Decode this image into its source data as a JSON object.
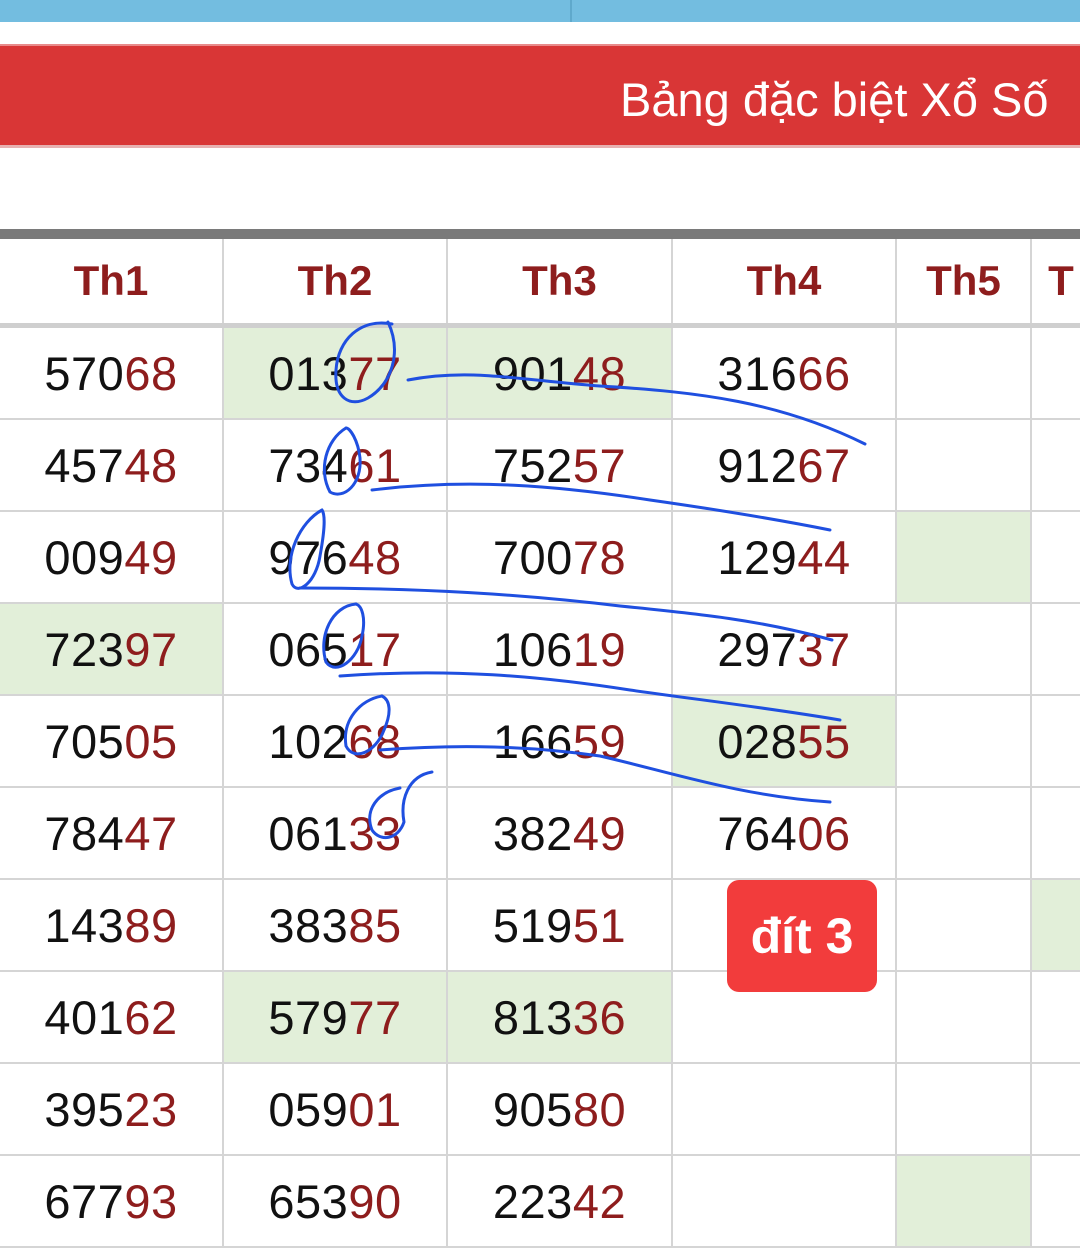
{
  "header": {
    "title": "Bảng đặc biệt Xổ Số"
  },
  "table": {
    "columns": [
      "Th1",
      "Th2",
      "Th3",
      "Th4",
      "Th5",
      "T"
    ],
    "rows": [
      [
        {
          "a": "570",
          "b": "68"
        },
        {
          "a": "013",
          "b": "77",
          "hl": true
        },
        {
          "a": "901",
          "b": "48",
          "hl": true
        },
        {
          "a": "316",
          "b": "66"
        },
        {},
        {}
      ],
      [
        {
          "a": "457",
          "b": "48"
        },
        {
          "a": "734",
          "b": "61"
        },
        {
          "a": "752",
          "b": "57"
        },
        {
          "a": "912",
          "b": "67"
        },
        {},
        {}
      ],
      [
        {
          "a": "009",
          "b": "49"
        },
        {
          "a": "976",
          "b": "48"
        },
        {
          "a": "700",
          "b": "78"
        },
        {
          "a": "129",
          "b": "44"
        },
        {
          "hl": true
        },
        {}
      ],
      [
        {
          "a": "723",
          "b": "97",
          "hl": true
        },
        {
          "a": "065",
          "b": "17"
        },
        {
          "a": "106",
          "b": "19"
        },
        {
          "a": "297",
          "b": "37"
        },
        {},
        {}
      ],
      [
        {
          "a": "705",
          "b": "05"
        },
        {
          "a": "102",
          "b": "68"
        },
        {
          "a": "166",
          "b": "59"
        },
        {
          "a": "028",
          "b": "55",
          "hl": true
        },
        {},
        {}
      ],
      [
        {
          "a": "784",
          "b": "47"
        },
        {
          "a": "061",
          "b": "33"
        },
        {
          "a": "382",
          "b": "49"
        },
        {
          "a": "764",
          "b": "06"
        },
        {},
        {}
      ],
      [
        {
          "a": "143",
          "b": "89"
        },
        {
          "a": "383",
          "b": "85"
        },
        {
          "a": "519",
          "b": "51"
        },
        {},
        {},
        {
          "hl": true
        }
      ],
      [
        {
          "a": "401",
          "b": "62"
        },
        {
          "a": "579",
          "b": "77",
          "hl": true
        },
        {
          "a": "813",
          "b": "36",
          "hl": true
        },
        {},
        {},
        {}
      ],
      [
        {
          "a": "395",
          "b": "23"
        },
        {
          "a": "059",
          "b": "01"
        },
        {
          "a": "905",
          "b": "80"
        },
        {},
        {},
        {}
      ],
      [
        {
          "a": "677",
          "b": "93"
        },
        {
          "a": "653",
          "b": "90"
        },
        {
          "a": "223",
          "b": "42"
        },
        {},
        {
          "hl": true
        },
        {}
      ]
    ]
  },
  "annotation": {
    "badge_text": "đít 3",
    "stroke_color": "#1f4fe0"
  },
  "colors": {
    "title_bar": "#d93636",
    "header_text": "#8e1d1d",
    "highlight": "#e2efd9",
    "badge": "#f23c3c"
  }
}
